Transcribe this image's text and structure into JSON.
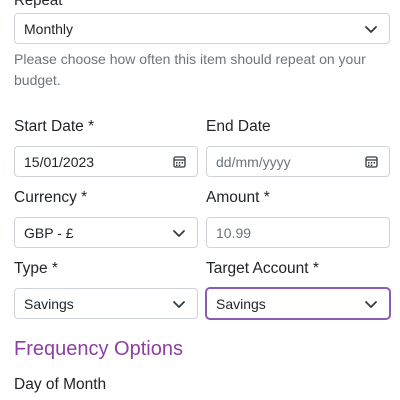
{
  "frequency": {
    "label_partial": "Repeat",
    "selected": "Monthly",
    "help_text": "Please choose how often this item should repeat on your budget."
  },
  "start_date": {
    "label": "Start Date *",
    "value": "15/01/2023"
  },
  "end_date": {
    "label": "End Date",
    "placeholder": "dd/mm/yyyy"
  },
  "currency": {
    "label": "Currency *",
    "selected": "GBP - £"
  },
  "amount": {
    "label": "Amount *",
    "placeholder": "10.99"
  },
  "type": {
    "label": "Type *",
    "selected": "Savings"
  },
  "target_account": {
    "label": "Target Account *",
    "selected": "Savings"
  },
  "frequency_options": {
    "title": "Frequency Options",
    "day_of_month_label": "Day of Month"
  },
  "colors": {
    "accent": "#8e3fa3",
    "focus_border": "#8c5bb3",
    "border": "#ced4da",
    "muted_text": "#6c757d"
  }
}
